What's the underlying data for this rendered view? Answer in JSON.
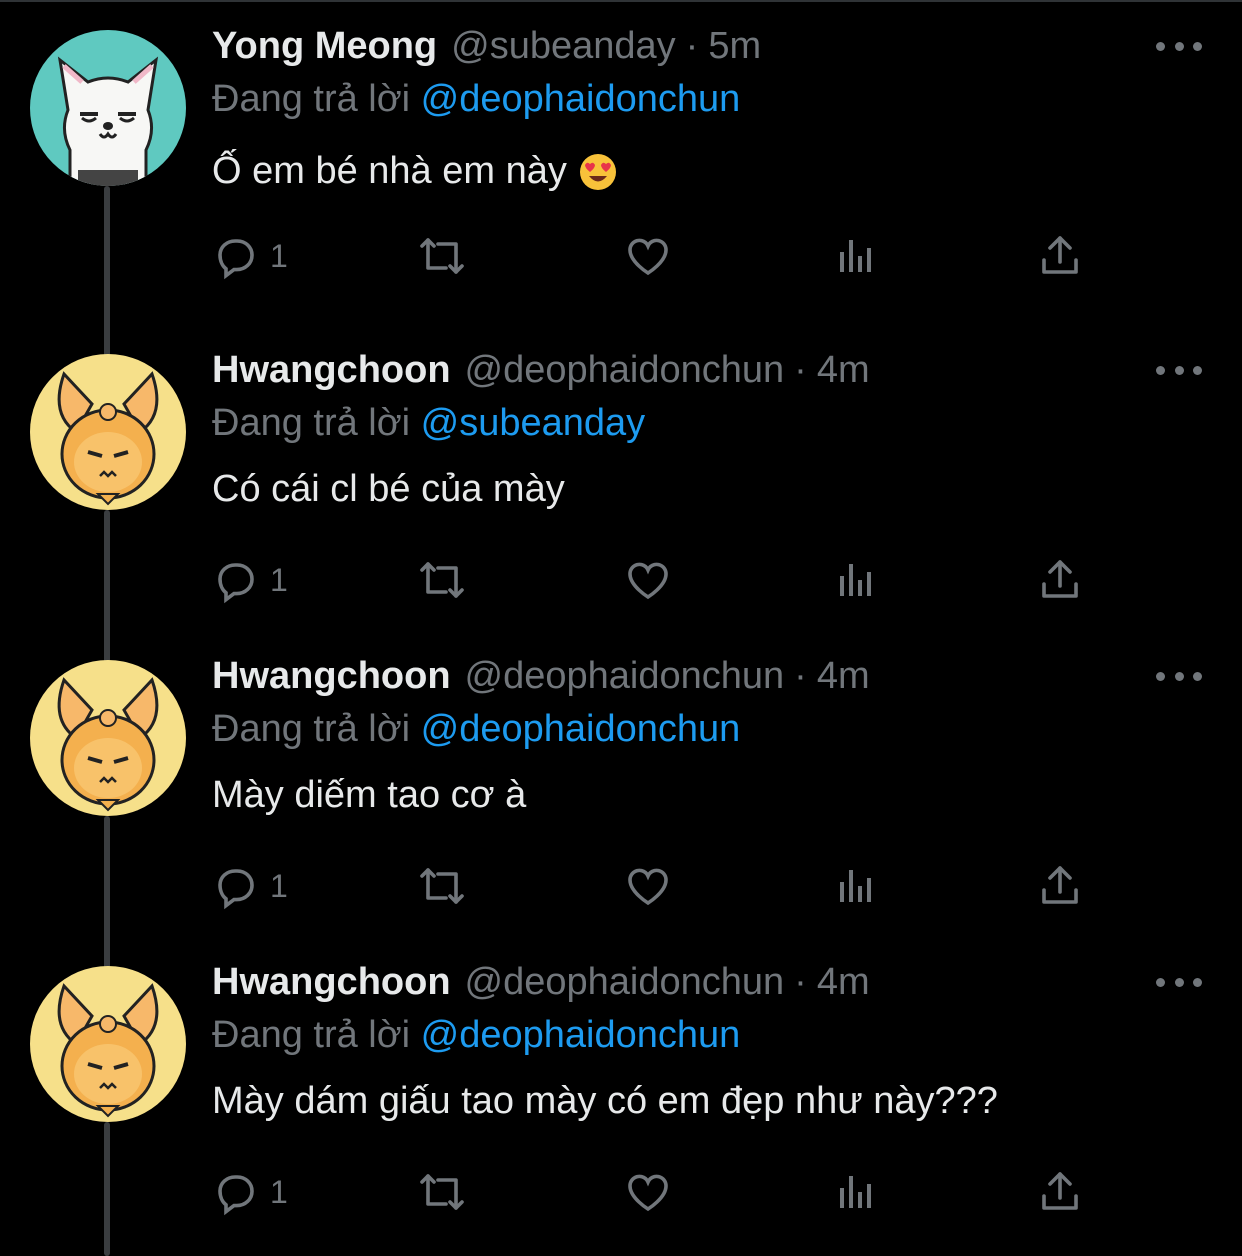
{
  "colors": {
    "background": "#000000",
    "name": "#e7e9ea",
    "muted": "#71767b",
    "mention": "#1d9bf0"
  },
  "reply_prefix": "Đang trả lời",
  "tweets": [
    {
      "name": "Yong Meong",
      "handle": "@subeanday",
      "separator": "·",
      "time": "5m",
      "replying_to": "@deophaidonchun",
      "text": "Ố em bé nhà em này",
      "emoji": "heart-eyes-emoji",
      "reply_count": "1",
      "avatar": "white-dog-avatar"
    },
    {
      "name": "Hwangchoon",
      "handle": "@deophaidonchun",
      "separator": "·",
      "time": "4m",
      "replying_to": "@subeanday",
      "text": "Có cái cl bé của mày",
      "reply_count": "1",
      "avatar": "bunny-hood-avatar"
    },
    {
      "name": "Hwangchoon",
      "handle": "@deophaidonchun",
      "separator": "·",
      "time": "4m",
      "replying_to": "@deophaidonchun",
      "text": "Mày diếm tao cơ à",
      "reply_count": "1",
      "avatar": "bunny-hood-avatar"
    },
    {
      "name": "Hwangchoon",
      "handle": "@deophaidonchun",
      "separator": "·",
      "time": "4m",
      "replying_to": "@deophaidonchun",
      "text": "Mày dám giấu tao mày có em đẹp như này???",
      "reply_count": "1",
      "avatar": "bunny-hood-avatar"
    }
  ]
}
